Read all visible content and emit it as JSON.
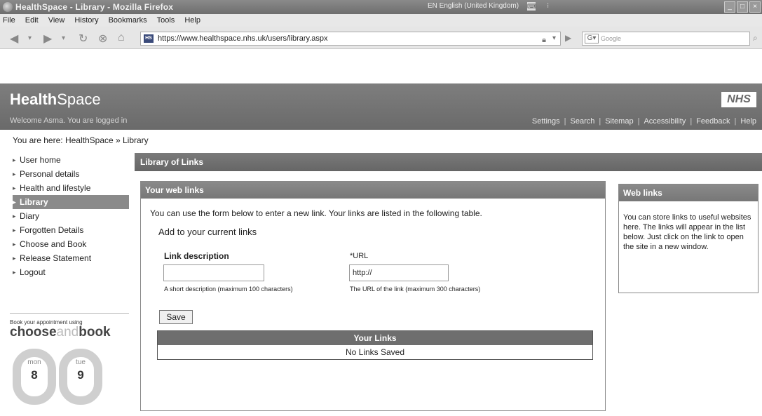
{
  "window": {
    "title": "HealthSpace - Library - Mozilla Firefox",
    "language": "EN English (United Kingdom)"
  },
  "menu": [
    "File",
    "Edit",
    "View",
    "History",
    "Bookmarks",
    "Tools",
    "Help"
  ],
  "toolbar": {
    "url": "https://www.healthspace.nhs.uk/users/library.aspx",
    "favicon_text": "HS",
    "search_placeholder": "Google"
  },
  "header": {
    "logo_bold": "Health",
    "logo_rest": "Space",
    "nhs": "NHS",
    "welcome": "Welcome Asma. You are logged in",
    "links": [
      "Settings",
      "Search",
      "Sitemap",
      "Accessibility",
      "Feedback",
      "Help"
    ]
  },
  "breadcrumb": "You are here: HealthSpace » Library",
  "sidebar": {
    "items": [
      {
        "label": "User home"
      },
      {
        "label": "Personal details"
      },
      {
        "label": "Health and lifestyle"
      },
      {
        "label": "Library",
        "active": true
      },
      {
        "label": "Diary"
      },
      {
        "label": "Forgotten Details"
      },
      {
        "label": "Choose and Book"
      },
      {
        "label": "Release Statement"
      },
      {
        "label": "Logout"
      }
    ],
    "cab_small": "Book your appointment using",
    "cab_word1": "choose",
    "cab_word2": "and",
    "cab_word3": "book",
    "cal_left": {
      "day": "mon",
      "num": "8"
    },
    "cal_right": {
      "day": "tue",
      "num": "9"
    }
  },
  "main": {
    "bar_title": "Library of Links",
    "panel_title": "Your web links",
    "intro": "You can use the form below to enter a new link. Your links are listed in the following table.",
    "add_title": "Add to your current links",
    "desc_label": "Link description",
    "desc_value": "",
    "desc_hint": "A short description (maximum 100 characters)",
    "url_label": "*URL",
    "url_value": "http://",
    "url_hint": "The URL of the link (maximum 300 characters)",
    "save_label": "Save",
    "table_header": "Your Links",
    "table_empty": "No Links Saved"
  },
  "rightbox": {
    "title": "Web links",
    "body": "You can store links to useful websites here. The links will appear in the list below. Just click on the link to open the site in a new window."
  }
}
